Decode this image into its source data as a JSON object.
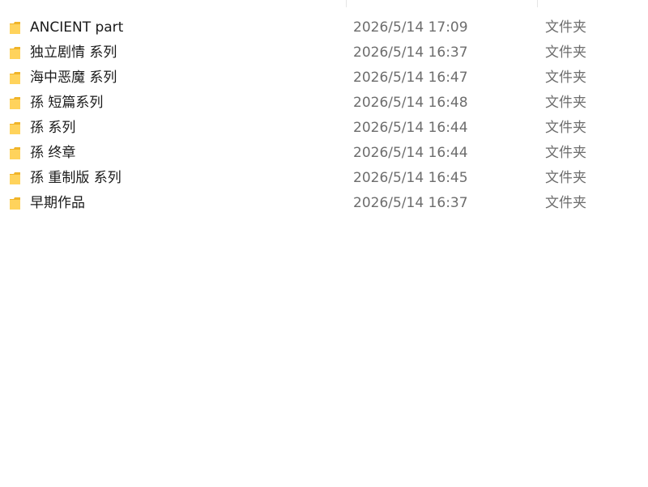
{
  "rows": [
    {
      "name": "ANCIENT part",
      "date": "2026/5/14 17:09",
      "type": "文件夹",
      "icon": "folder-icon"
    },
    {
      "name": "独立剧情 系列",
      "date": "2026/5/14 16:37",
      "type": "文件夹",
      "icon": "folder-icon"
    },
    {
      "name": "海中恶魔 系列",
      "date": "2026/5/14 16:47",
      "type": "文件夹",
      "icon": "folder-icon"
    },
    {
      "name": "孫 短篇系列",
      "date": "2026/5/14 16:48",
      "type": "文件夹",
      "icon": "folder-icon"
    },
    {
      "name": "孫 系列",
      "date": "2026/5/14 16:44",
      "type": "文件夹",
      "icon": "folder-icon"
    },
    {
      "name": "孫 终章",
      "date": "2026/5/14 16:44",
      "type": "文件夹",
      "icon": "folder-icon"
    },
    {
      "name": "孫 重制版 系列",
      "date": "2026/5/14 16:45",
      "type": "文件夹",
      "icon": "folder-icon"
    },
    {
      "name": "早期作品",
      "date": "2026/5/14 16:37",
      "type": "文件夹",
      "icon": "folder-icon"
    }
  ],
  "colors": {
    "folder_front": "#ffd35c",
    "folder_back": "#f0b429",
    "name_text": "#1a1a1a",
    "meta_text": "#6d6d6d"
  }
}
